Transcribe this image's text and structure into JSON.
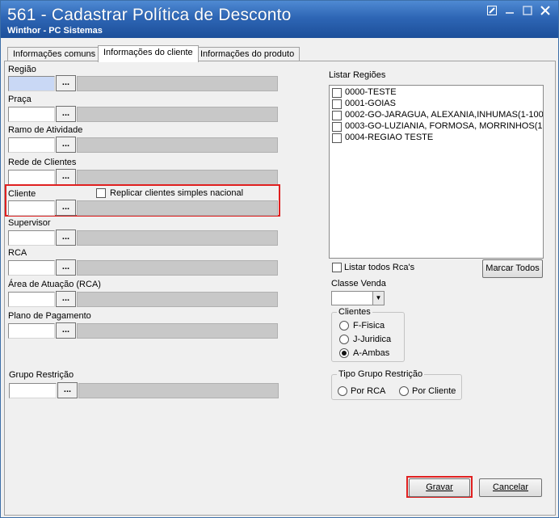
{
  "window": {
    "title": "561 - Cadastrar Política de Desconto",
    "subtitle": "Winthor - PC Sistemas",
    "controls": [
      "edit-icon",
      "minimize-icon",
      "maximize-icon",
      "close-icon"
    ]
  },
  "tabs": [
    {
      "label": "Informações comuns",
      "active": false
    },
    {
      "label": "Informações do cliente",
      "active": true
    },
    {
      "label": "Informações do produto",
      "active": false
    }
  ],
  "fields": {
    "regiao": {
      "label": "Região",
      "value": "",
      "button": "..."
    },
    "praca": {
      "label": "Praça",
      "value": "",
      "button": "..."
    },
    "ramo": {
      "label": "Ramo de Atividade",
      "value": "",
      "button": "..."
    },
    "rede": {
      "label": "Rede de Clientes",
      "value": "",
      "button": "..."
    },
    "cliente": {
      "label": "Cliente",
      "value": "",
      "button": "...",
      "checkbox_label": "Replicar clientes simples nacional",
      "checked": false
    },
    "supervisor": {
      "label": "Supervisor",
      "value": "",
      "button": "..."
    },
    "rca": {
      "label": "RCA",
      "value": "",
      "button": "..."
    },
    "area": {
      "label": "Área de Atuação (RCA)",
      "value": "",
      "button": "..."
    },
    "plano": {
      "label": "Plano de Pagamento",
      "value": "",
      "button": "..."
    },
    "grupo": {
      "label": "Grupo Restrição",
      "value": "",
      "button": "..."
    }
  },
  "regioes": {
    "label": "Listar Regiões",
    "items": [
      "0000-TESTE",
      "0001-GOIAS",
      "0002-GO-JARAGUA, ALEXANIA,INHUMAS(1-100)",
      "0003-GO-LUZIANIA, FORMOSA, MORRINHOS(101-",
      "0004-REGIAO TESTE"
    ]
  },
  "listar_rcas": {
    "label": "Listar todos Rca's",
    "checked": false
  },
  "marcar_todos": "Marcar Todos",
  "classe_venda": {
    "label": "Classe Venda",
    "value": ""
  },
  "clientes_group": {
    "title": "Clientes",
    "options": [
      {
        "label": "F-Fisica",
        "selected": false
      },
      {
        "label": "J-Juridica",
        "selected": false
      },
      {
        "label": "A-Ambas",
        "selected": true
      }
    ]
  },
  "tipo_grupo": {
    "title": "Tipo Grupo Restrição",
    "options": [
      {
        "label": "Por RCA",
        "selected": false
      },
      {
        "label": "Por Cliente",
        "selected": false
      }
    ]
  },
  "actions": {
    "gravar": "Gravar",
    "cancelar": "Cancelar"
  },
  "colors": {
    "titlebar": "#2e66b5",
    "highlight": "#e02020",
    "panel": "#f0f0f0"
  }
}
